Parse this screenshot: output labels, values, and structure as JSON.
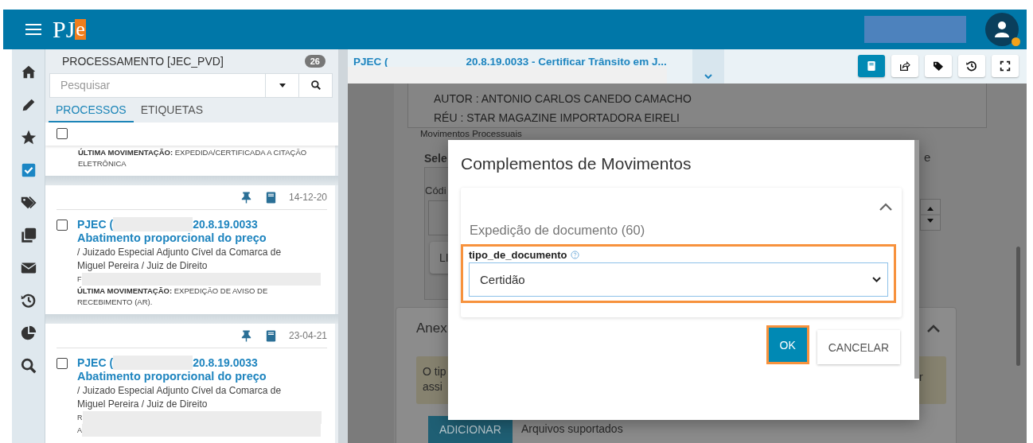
{
  "header": {
    "logo_main": "PJ",
    "logo_accent": "e",
    "user": {
      "status_dot": true
    }
  },
  "sidebar": {
    "items": [
      {
        "kind": "home",
        "selected": false
      },
      {
        "kind": "pencil",
        "selected": false
      },
      {
        "kind": "star",
        "selected": false
      },
      {
        "kind": "checkbox",
        "selected": true
      },
      {
        "kind": "tags",
        "selected": false
      },
      {
        "kind": "copies",
        "selected": false
      },
      {
        "kind": "envelope",
        "selected": false
      },
      {
        "kind": "history",
        "selected": false
      },
      {
        "kind": "pie",
        "selected": false
      },
      {
        "kind": "search",
        "selected": false
      }
    ]
  },
  "list_panel": {
    "title": "PROCESSAMENTO [JEC_PVD]",
    "count": "26",
    "search": {
      "placeholder": "Pesquisar"
    },
    "tabs": [
      {
        "label": "PROCESSOS",
        "selected": true
      },
      {
        "label": "ETIQUETAS",
        "selected": false
      }
    ],
    "select_all": {
      "checked": false
    },
    "partial_card": {
      "movement_label": "ÚLTIMA MOVIMENTAÇÃO:",
      "movement": "EXPEDIDA/CERTIFICADA A CITAÇÃO ELETRÔNICA"
    },
    "cards": [
      {
        "date": "14-12-20",
        "checked": false,
        "number_start": "PJEC (",
        "number_end": "20.8.19.0033",
        "subject": "Abatimento proporcional do preço",
        "court": "/ Juizado Especial Adjunto Cível da Comarca de Miguel Pereira / Juiz de Direito",
        "extra_lines": [
          "F"
        ],
        "movement_label": "ÚLTIMA MOVIMENTAÇÃO:",
        "movement": "EXPEDIÇÃO DE AVISO DE RECEBIMENTO (AR)."
      },
      {
        "date": "23-04-21",
        "checked": false,
        "number_start": "PJEC (",
        "number_end": "20.8.19.0033",
        "subject": "Abatimento proporcional do preço",
        "court": "/ Juizado Especial Adjunto Cível da Comarca de Miguel Pereira / Juiz de Direito",
        "extra_lines": [
          "R",
          "A"
        ]
      }
    ]
  },
  "document": {
    "title_start": "PJEC (",
    "title_end": "20.8.19.0033 - Certificar Trânsito em J...",
    "toolbar": [
      {
        "kind": "book",
        "selected": true
      },
      {
        "kind": "share",
        "selected": false
      },
      {
        "kind": "tag",
        "selected": false
      },
      {
        "kind": "history",
        "selected": false
      },
      {
        "kind": "expand",
        "selected": false
      }
    ],
    "parties": [
      "AUTOR : ANTONIO CARLOS CANEDO CAMACHO",
      "RÉU : STAR MAGAZINE IMPORTADORA EIRELI"
    ],
    "section_label": "Movimentos Processuais",
    "select_fragment": "Sele",
    "code_fragment": "Códi",
    "button_fragment": "LI",
    "right_fragment": "e",
    "attachments": {
      "title_fragment": "Anex",
      "notice_fragments": [
        "O tip",
        "assi"
      ],
      "notice_right_fragment": "r",
      "add_button": "ADICIONAR",
      "supported": "Arquivos suportados"
    }
  },
  "dialog": {
    "title": "Complementos de Movimentos",
    "section": {
      "title": "Expedição de documento (60)",
      "expanded": true,
      "field": {
        "label": "tipo_de_documento",
        "value": "Certidão",
        "highlighted": true
      }
    },
    "buttons": [
      {
        "label": "OK",
        "kind": "primary",
        "highlighted": true
      },
      {
        "label": "CANCELAR",
        "kind": "secondary",
        "highlighted": false
      }
    ]
  }
}
